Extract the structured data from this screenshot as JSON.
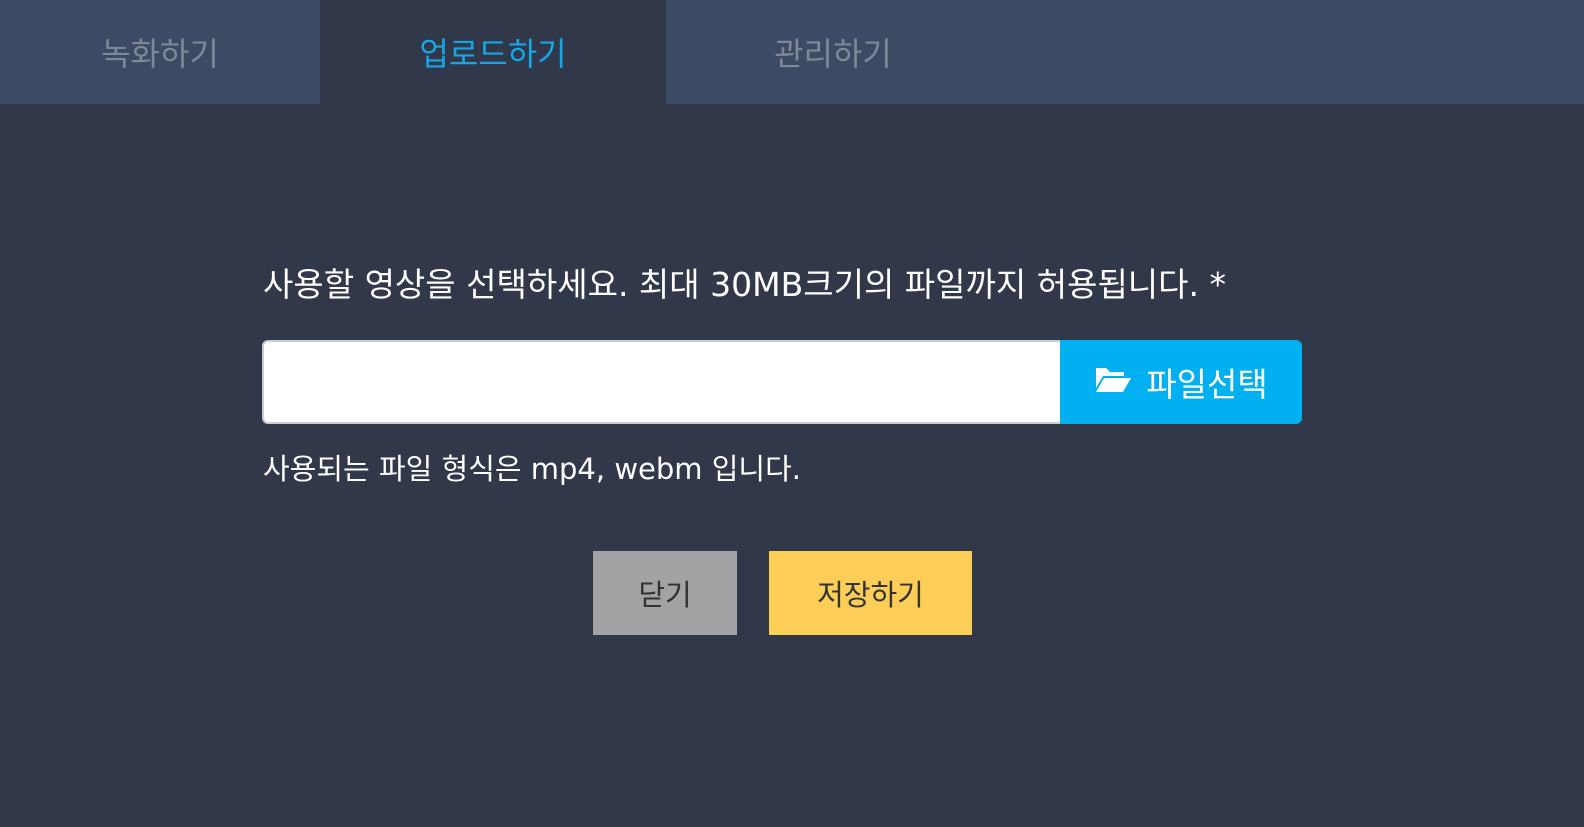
{
  "tabs": [
    {
      "label": "녹화하기",
      "active": false
    },
    {
      "label": "업로드하기",
      "active": true
    },
    {
      "label": "관리하기",
      "active": false
    }
  ],
  "upload": {
    "prompt": "사용할 영상을 선택하세요. 최대 30MB크기의 파일까지 허용됩니다. *",
    "file_value": "",
    "file_button_label": "파일선택",
    "file_button_icon": "folder-open-icon",
    "hint": "사용되는 파일 형식은 mp4, webm 입니다."
  },
  "actions": {
    "close_label": "닫기",
    "save_label": "저장하기"
  },
  "colors": {
    "background": "#303849",
    "tabbar": "#3d4a63",
    "active_tab_text": "#17a7e6",
    "file_button": "#00b0f0",
    "close_button": "#a3a3a5",
    "save_button": "#fccd57"
  }
}
